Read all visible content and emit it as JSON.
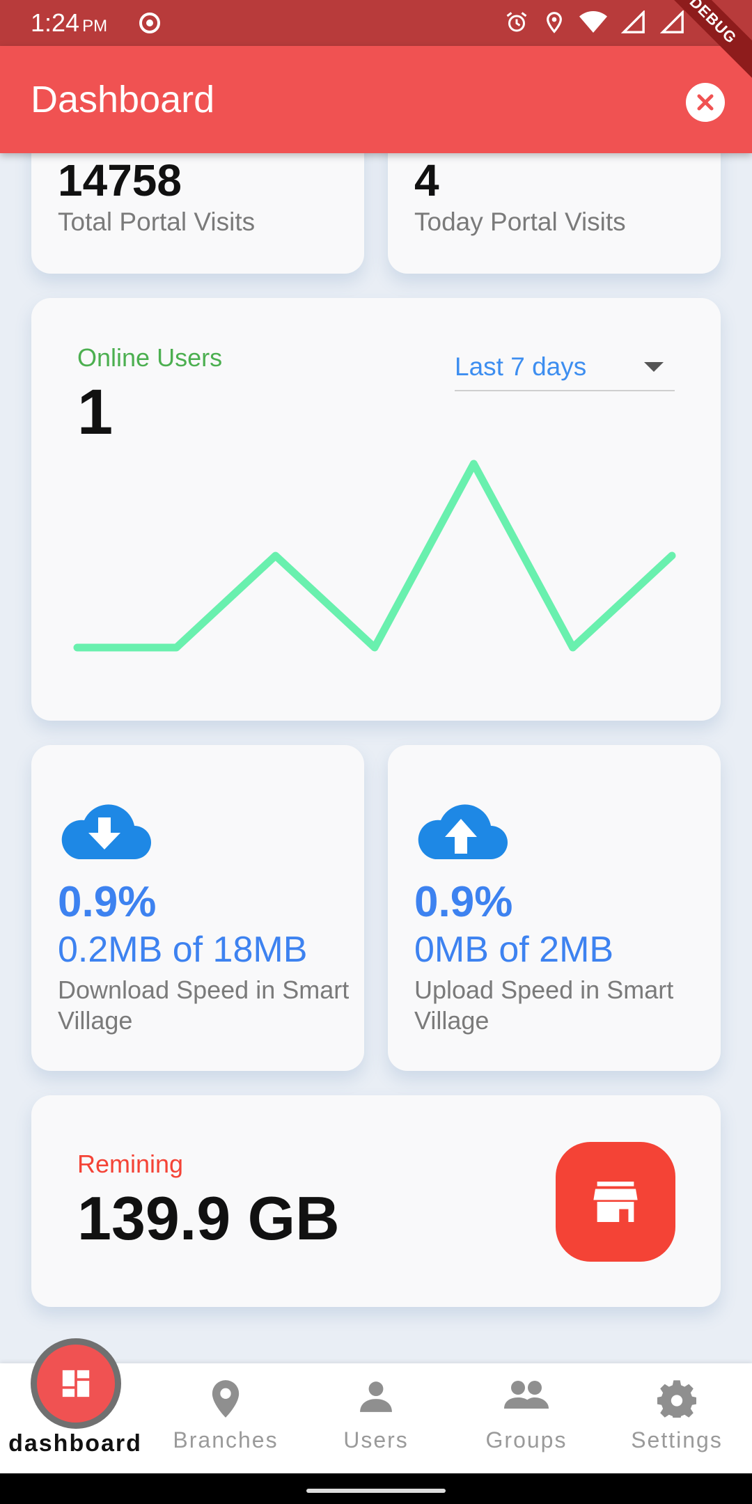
{
  "status": {
    "time": "1:24",
    "ampm": "PM"
  },
  "app_bar": {
    "title": "Dashboard",
    "debug": "DEBUG"
  },
  "visits": {
    "total": {
      "value": "14758",
      "label": "Total Portal Visits"
    },
    "today": {
      "value": "4",
      "label": "Today Portal Visits"
    }
  },
  "online_users": {
    "label": "Online Users",
    "value": "1",
    "range_selected": "Last 7 days",
    "label_color": "#4caf50",
    "line_color": "#69f0ae",
    "series": [
      0,
      0,
      1,
      0,
      2,
      0,
      1
    ]
  },
  "speed": {
    "download": {
      "percent": "0.9%",
      "amount": "0.2MB of 18MB",
      "label": "Download Speed in Smart Village",
      "icon": "cloud-download-icon"
    },
    "upload": {
      "percent": "0.9%",
      "amount": "0MB of 2MB",
      "label": "Upload Speed in Smart Village",
      "icon": "cloud-upload-icon"
    },
    "accent": "#3d82f0"
  },
  "remaining": {
    "label": "Remining",
    "value": "139.9 GB",
    "icon": "store-icon",
    "accent": "#f44336"
  },
  "nav": {
    "items": [
      {
        "label": "dashboard",
        "icon": "dashboard-icon",
        "active": true
      },
      {
        "label": "Branches",
        "icon": "location-pin-icon"
      },
      {
        "label": "Users",
        "icon": "person-icon"
      },
      {
        "label": "Groups",
        "icon": "group-icon"
      },
      {
        "label": "Settings",
        "icon": "gear-icon"
      }
    ]
  }
}
